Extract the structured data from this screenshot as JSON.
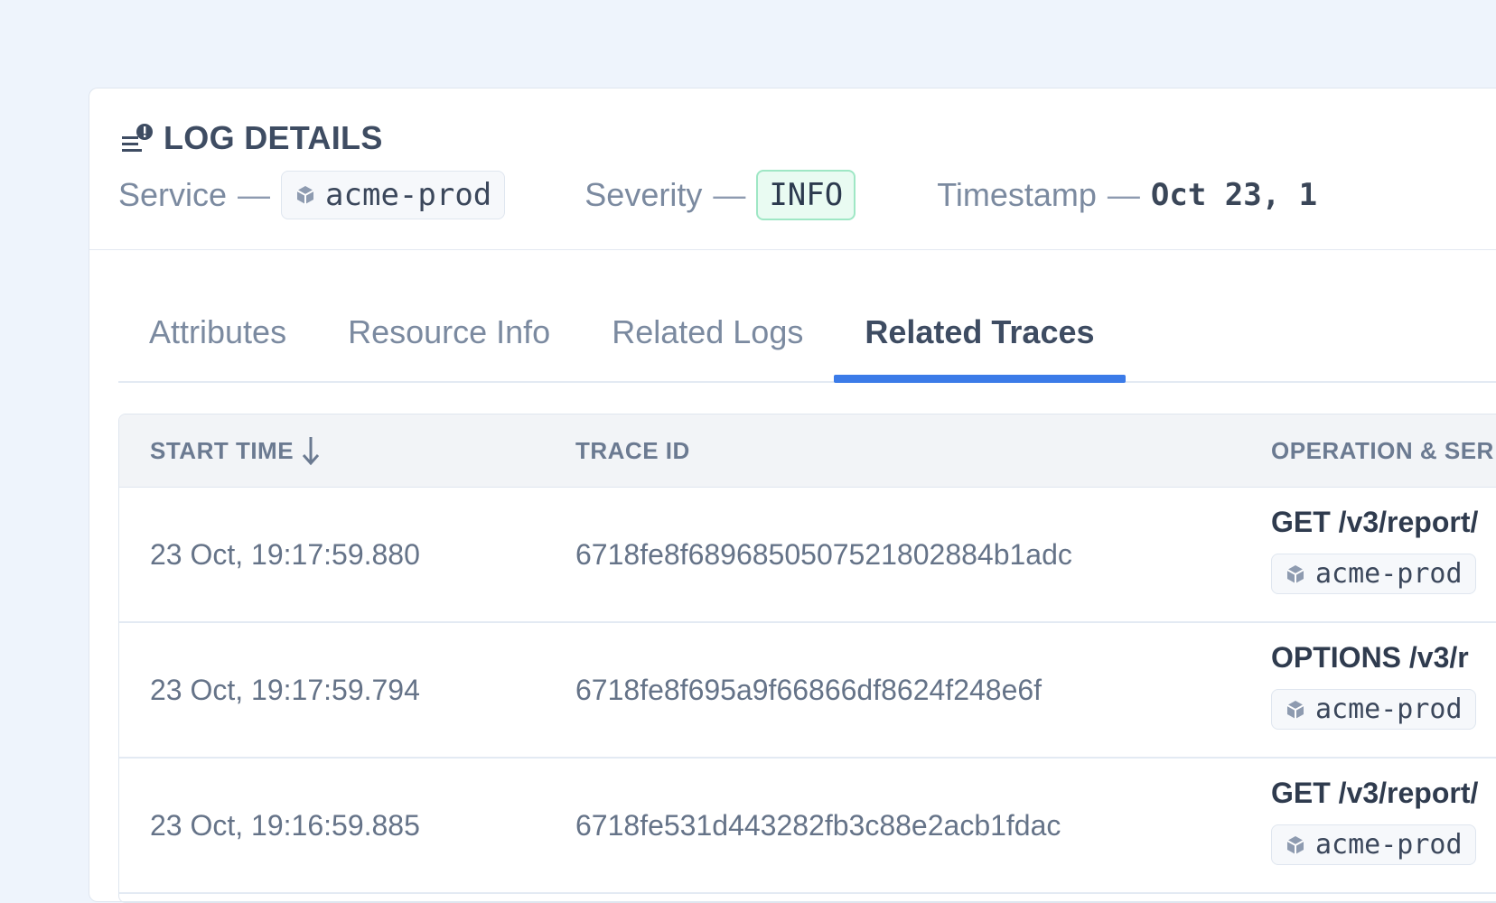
{
  "header": {
    "title": "LOG DETAILS",
    "title_icon": "log-alert-icon",
    "service_label": "Service",
    "service_value": "acme-prod",
    "severity_label": "Severity",
    "severity_value": "INFO",
    "timestamp_label": "Timestamp",
    "timestamp_value": "Oct 23, 1",
    "dash": "—"
  },
  "tabs": [
    {
      "label": "Attributes",
      "active": false
    },
    {
      "label": "Resource Info",
      "active": false
    },
    {
      "label": "Related Logs",
      "active": false
    },
    {
      "label": "Related Traces",
      "active": true
    }
  ],
  "table": {
    "columns": [
      {
        "label": "START TIME",
        "sort": "desc"
      },
      {
        "label": "TRACE ID"
      },
      {
        "label": "OPERATION & SER"
      }
    ],
    "rows": [
      {
        "start_time": "23 Oct, 19:17:59.880",
        "trace_id": "6718fe8f6896850507521802884b1adc",
        "operation": "GET /v3/report/",
        "service": "acme-prod"
      },
      {
        "start_time": "23 Oct, 19:17:59.794",
        "trace_id": "6718fe8f695a9f66866df8624f248e6f",
        "operation": "OPTIONS /v3/r",
        "service": "acme-prod"
      },
      {
        "start_time": "23 Oct, 19:16:59.885",
        "trace_id": "6718fe531d443282fb3c88e2acb1fdac",
        "operation": "GET /v3/report/",
        "service": "acme-prod"
      }
    ]
  },
  "colors": {
    "accent": "#3b7be8",
    "background": "#eef4fc",
    "severity_info_bg": "#e9fbf2",
    "severity_info_border": "#9fe7c5"
  }
}
